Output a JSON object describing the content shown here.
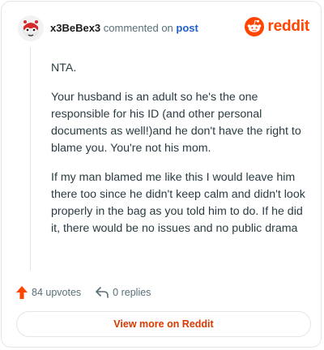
{
  "header": {
    "username": "x3BeBex3",
    "commented_on": "commented on",
    "post_link": "post",
    "brand": "reddit"
  },
  "comment": {
    "paragraphs": [
      "NTA.",
      "Your husband is an adult so he's the one responsible for his ID (and other personal documents as well!)and he don't have the right to blame you. You're not his mom.",
      "If my man blamed me like this I would leave him there too since he didn't keep calm and didn't look properly in the bag as you told him to do. If he did it, there would be no issues and no public drama"
    ]
  },
  "actions": {
    "upvotes": "84 upvotes",
    "replies": "0 replies"
  },
  "footer": {
    "view_more": "View more on Reddit"
  },
  "colors": {
    "accent": "#ff4500",
    "link": "#1e5fc9",
    "button_text": "#d93900"
  },
  "icons": [
    "avatar",
    "reddit-logo-icon",
    "upvote-arrow-icon",
    "reply-arrow-icon"
  ]
}
